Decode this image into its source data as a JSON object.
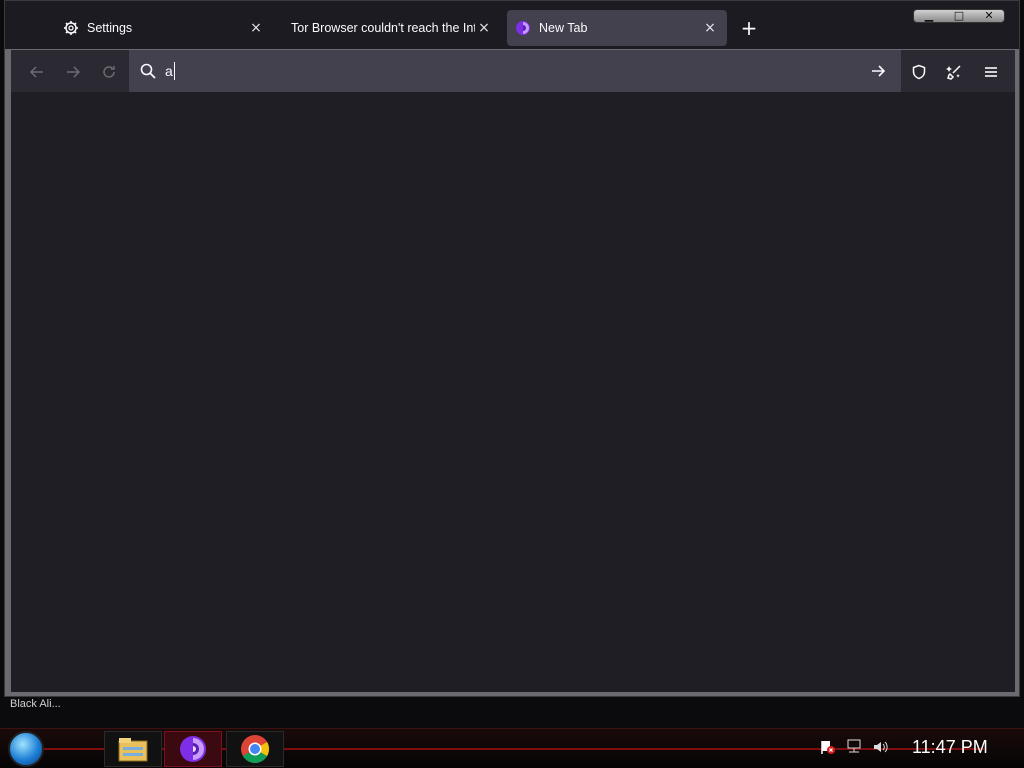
{
  "browser": {
    "tabs": [
      {
        "label": "Settings",
        "icon": "gear-icon",
        "active": false
      },
      {
        "label": "Tor Browser couldn't reach the Inter",
        "icon": "none",
        "active": false
      },
      {
        "label": "New Tab",
        "icon": "tor-onion-icon",
        "active": true
      }
    ],
    "close_glyph": "×",
    "new_tab_glyph": "+",
    "window_controls": {
      "minimize": "▁",
      "maximize": "□",
      "close": "✕"
    },
    "urlbar": {
      "value": "a",
      "placeholder": ""
    },
    "status_text": "Black Ali..."
  },
  "taskbar": {
    "clock": "11:47 PM",
    "items": [
      "file-explorer-icon",
      "tor-browser-icon",
      "chrome-icon"
    ],
    "tray": [
      "network-error-icon",
      "network-icon",
      "volume-icon"
    ]
  },
  "colors": {
    "titlebar": "#1c1b22",
    "toolbar": "#2b2a33",
    "urlbar": "#42414d",
    "content": "#1f1e25",
    "tor_purple": "#7d2ee6",
    "taskbar_red": "#b01010"
  }
}
